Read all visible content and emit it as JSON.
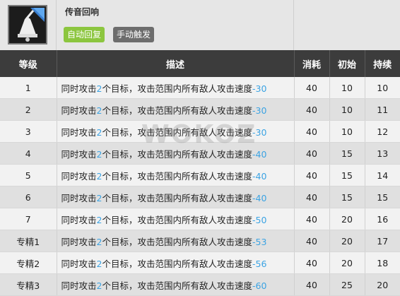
{
  "skill": {
    "name": "传音回响",
    "icon": "bell-icon",
    "tags": [
      "自动回复",
      "手动触发"
    ]
  },
  "table": {
    "headers": [
      "等级",
      "描述",
      "消耗",
      "初始",
      "持续"
    ],
    "desc_parts": [
      "同时攻击",
      "个目标，攻击范围内所有敌人攻击速度"
    ],
    "rows": [
      {
        "level": "1",
        "targets": "2",
        "speed": "-30",
        "cost": "40",
        "init": "10",
        "duration": "10"
      },
      {
        "level": "2",
        "targets": "2",
        "speed": "-30",
        "cost": "40",
        "init": "10",
        "duration": "11"
      },
      {
        "level": "3",
        "targets": "2",
        "speed": "-30",
        "cost": "40",
        "init": "10",
        "duration": "12"
      },
      {
        "level": "4",
        "targets": "2",
        "speed": "-40",
        "cost": "40",
        "init": "15",
        "duration": "13"
      },
      {
        "level": "5",
        "targets": "2",
        "speed": "-40",
        "cost": "40",
        "init": "15",
        "duration": "14"
      },
      {
        "level": "6",
        "targets": "2",
        "speed": "-40",
        "cost": "40",
        "init": "15",
        "duration": "15"
      },
      {
        "level": "7",
        "targets": "2",
        "speed": "-50",
        "cost": "40",
        "init": "20",
        "duration": "16"
      },
      {
        "level": "专精1",
        "targets": "2",
        "speed": "-53",
        "cost": "40",
        "init": "20",
        "duration": "17"
      },
      {
        "level": "专精2",
        "targets": "2",
        "speed": "-56",
        "cost": "40",
        "init": "20",
        "duration": "18"
      },
      {
        "level": "专精3",
        "targets": "2",
        "speed": "-60",
        "cost": "40",
        "init": "25",
        "duration": "20"
      }
    ]
  },
  "watermark": "WOKOZ",
  "colors": {
    "header_bg": "#3c3c3c",
    "highlight": "#3ba3e3",
    "tag_green": "#8cc63f",
    "tag_gray": "#6d6d6d"
  }
}
